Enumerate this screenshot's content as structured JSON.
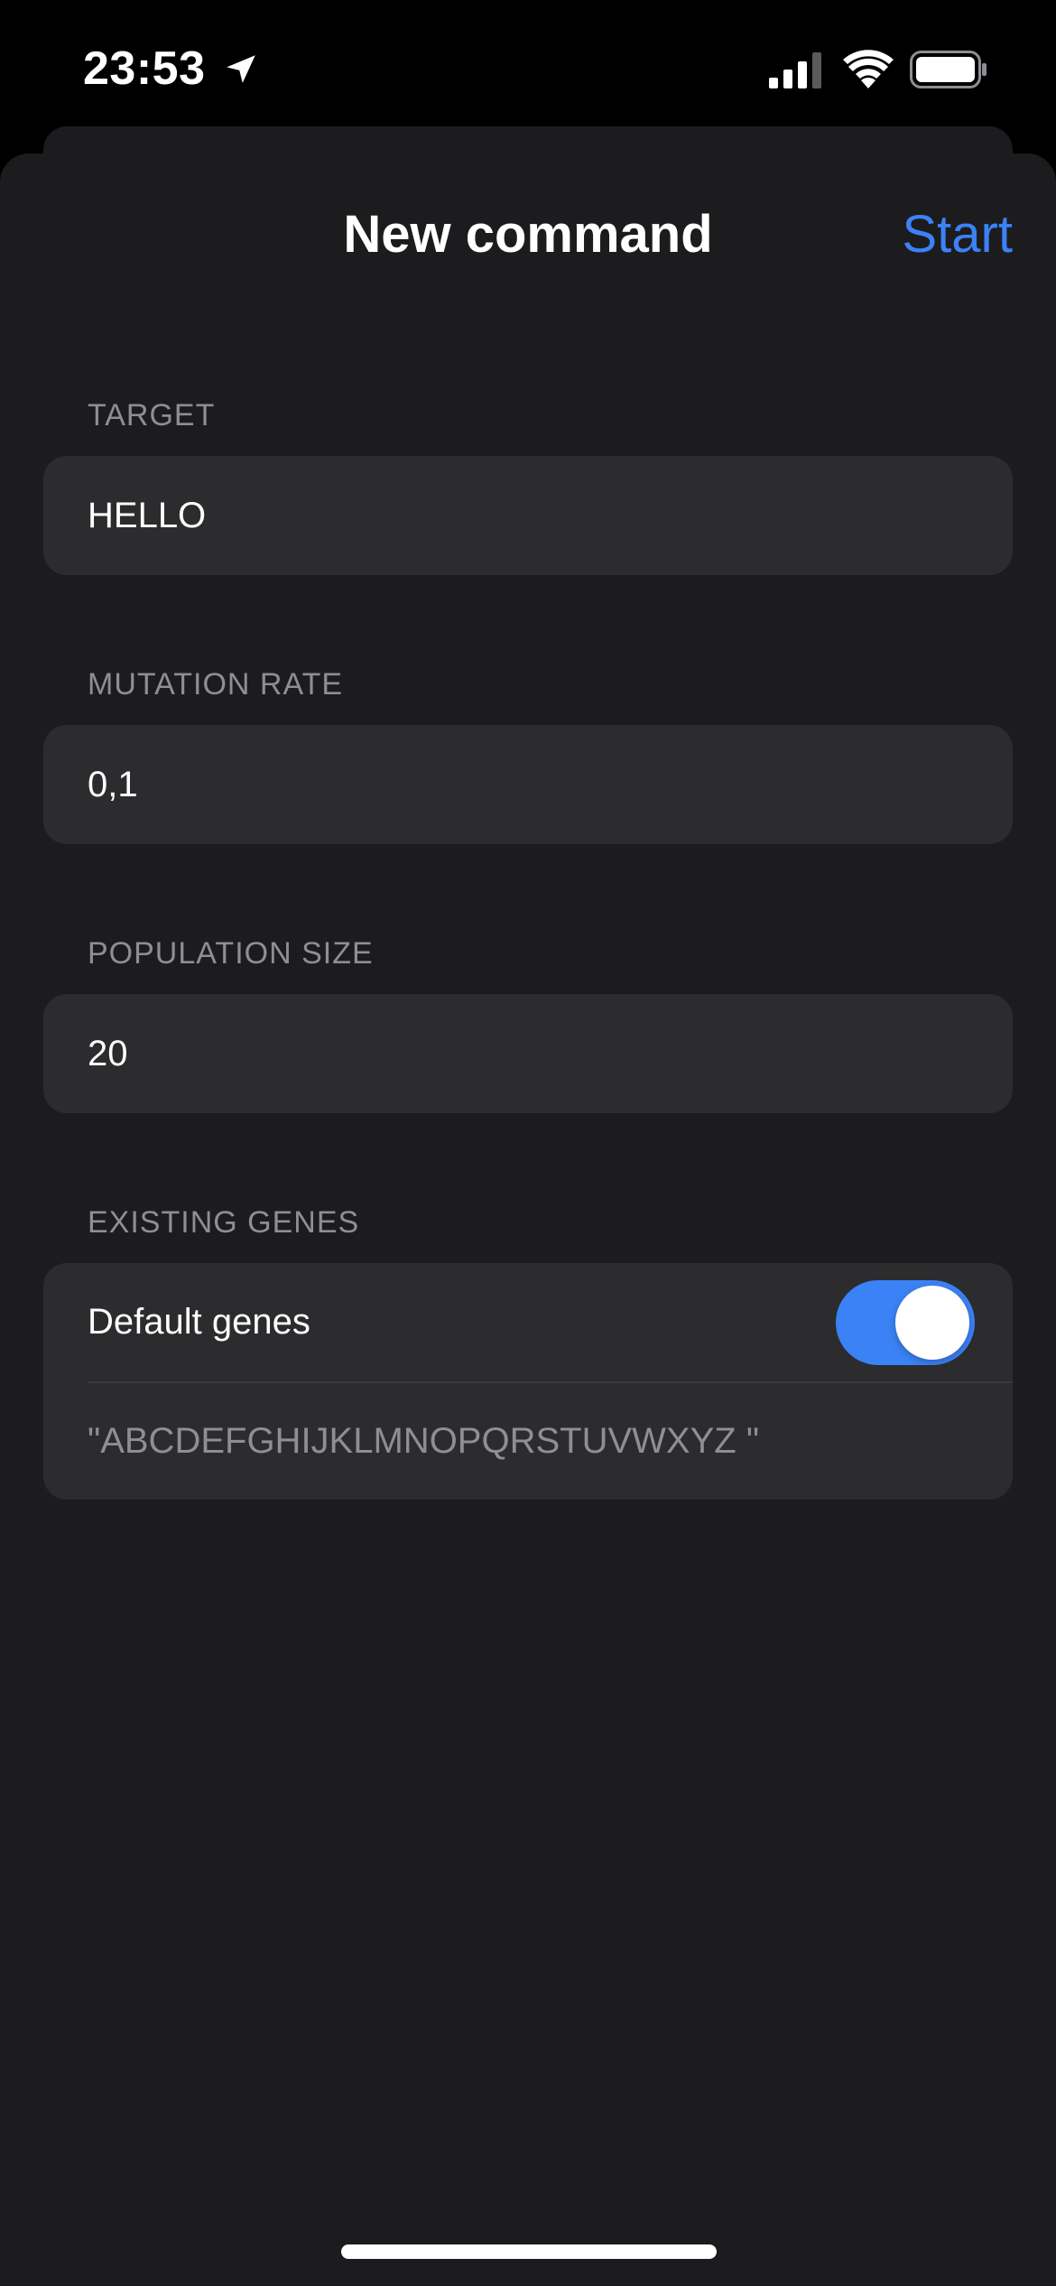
{
  "status_bar": {
    "time": "23:53",
    "icons": [
      "location-arrow-icon",
      "cellular-signal-icon",
      "wifi-icon",
      "battery-icon"
    ]
  },
  "nav": {
    "title": "New command",
    "action_label": "Start"
  },
  "form": {
    "target": {
      "label": "TARGET",
      "value": "HELLO"
    },
    "mutation_rate": {
      "label": "MUTATION RATE",
      "value": "0,1"
    },
    "population_size": {
      "label": "POPULATION SIZE",
      "value": "20"
    },
    "existing_genes": {
      "label": "EXISTING GENES",
      "toggle_label": "Default genes",
      "toggle_on": true,
      "genes_value": "\"ABCDEFGHIJKLMNOPQRSTUVWXYZ \""
    }
  },
  "colors": {
    "background": "#000000",
    "sheet": "#1c1c1e",
    "field": "#2c2c2e",
    "accent": "#3b82f6",
    "secondary_text": "#8e8e93"
  }
}
